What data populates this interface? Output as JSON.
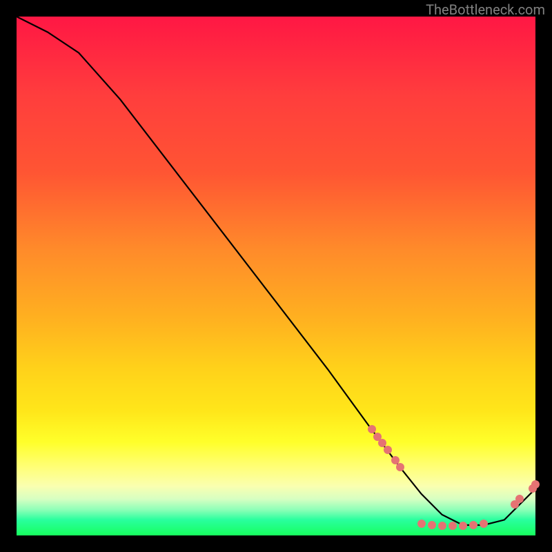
{
  "watermark": "TheBottleneck.com",
  "colors": {
    "page_bg": "#000000",
    "watermark": "#808080",
    "curve": "#000000",
    "marker": "#e57373"
  },
  "chart_data": {
    "type": "line",
    "title": "",
    "xlabel": "",
    "ylabel": "",
    "xlim": [
      0,
      100
    ],
    "ylim": [
      0,
      100
    ],
    "grid": false,
    "legend": false,
    "series": [
      {
        "name": "bottleneck-curve",
        "x": [
          0,
          6,
          12,
          20,
          30,
          40,
          50,
          60,
          68,
          74,
          78,
          82,
          86,
          90,
          94,
          97,
          100
        ],
        "values": [
          100,
          97,
          93,
          84,
          71,
          58,
          45,
          32,
          21,
          13,
          8,
          4,
          2,
          2,
          3,
          6,
          9
        ]
      }
    ],
    "markers": {
      "name": "highlight-points",
      "x": [
        68.5,
        69.5,
        70.5,
        71.5,
        73.0,
        74.0,
        78.0,
        80.0,
        82.0,
        84.0,
        86.0,
        88.0,
        90.0,
        96.0,
        97.0,
        99.5,
        100.0
      ],
      "values": [
        20.5,
        19.0,
        17.8,
        16.5,
        14.5,
        13.2,
        2.2,
        2.0,
        1.9,
        1.9,
        1.9,
        2.0,
        2.2,
        6.0,
        7.0,
        9.0,
        9.8
      ]
    }
  }
}
